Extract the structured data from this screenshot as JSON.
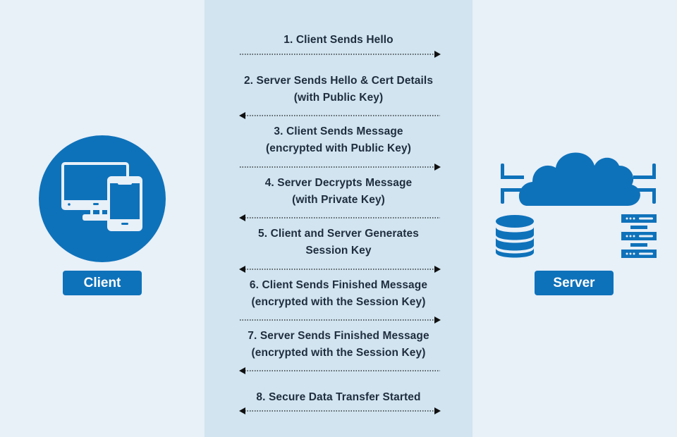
{
  "colors": {
    "background": "#e8f0f8",
    "center_band": "#d1e4f0",
    "accent": "#0e72ba",
    "text": "#1f2d3d",
    "arrow": "#111111"
  },
  "client": {
    "label": "Client",
    "icon": "devices-icon"
  },
  "server": {
    "label": "Server",
    "icons": [
      "cloud-icon",
      "database-icon",
      "server-rack-icon"
    ]
  },
  "steps": [
    {
      "number": "1.",
      "line1_pre": "Client Sends ",
      "line1_bold": "Hello",
      "line1_post": "",
      "line2_pre": "",
      "line2_bold": "",
      "direction": "right"
    },
    {
      "number": "2.",
      "line1_pre": "Server Sends ",
      "line1_bold": "Hello",
      "line1_post": " & Cert Details",
      "line2_pre": "(with Public Key)",
      "line2_bold": "",
      "direction": "left"
    },
    {
      "number": "3.",
      "line1_pre": "Client Sends ",
      "line1_bold": "Message",
      "line1_post": "",
      "line2_pre": "(encrypted with Public Key)",
      "line2_bold": "",
      "direction": "right"
    },
    {
      "number": "4.",
      "line1_pre": "Server Decrypts ",
      "line1_bold": "Message",
      "line1_post": "",
      "line2_pre": "(with Private Key)",
      "line2_bold": "",
      "direction": "left"
    },
    {
      "number": "5.",
      "line1_pre": "Client and Server Generates",
      "line1_bold": "",
      "line1_post": "",
      "line2_pre": "",
      "line2_bold": "Session Key",
      "direction": "both"
    },
    {
      "number": "6.",
      "line1_pre": "Client Sends ",
      "line1_bold": "Finished Message",
      "line1_post": "",
      "line2_pre": "(encrypted with the Session Key)",
      "line2_bold": "",
      "direction": "right"
    },
    {
      "number": "7.",
      "line1_pre": "Server Sends ",
      "line1_bold": "Finished Message",
      "line1_post": "",
      "line2_pre": "(encrypted with the Session Key)",
      "line2_bold": "",
      "direction": "left"
    },
    {
      "number": "8.",
      "line1_pre": "Secure Data Transfer Started",
      "line1_bold": "",
      "line1_post": "",
      "line2_pre": "",
      "line2_bold": "",
      "direction": "both"
    }
  ]
}
